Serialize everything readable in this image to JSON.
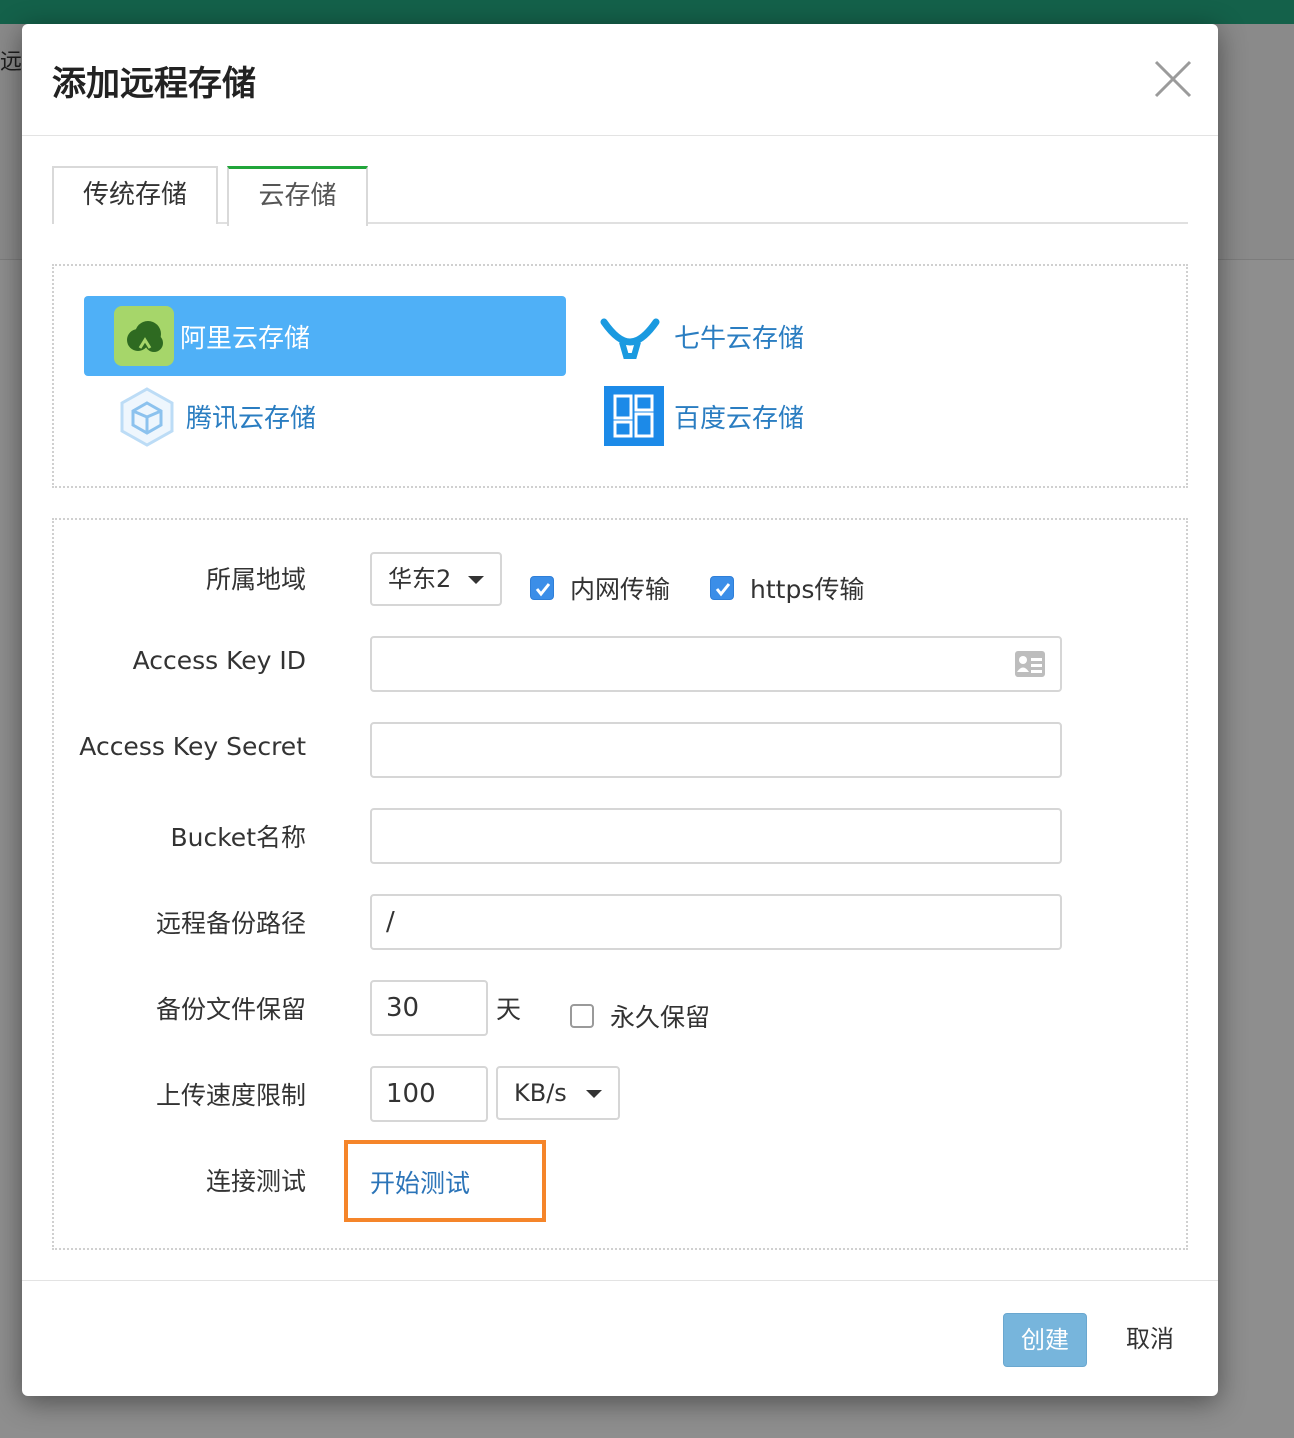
{
  "background": {
    "partial_text": "远"
  },
  "dialog": {
    "title": "添加远程存储",
    "tabs": [
      {
        "label": "传统存储"
      },
      {
        "label": "云存储",
        "active": true
      }
    ],
    "providers": [
      {
        "label": "阿里云存储",
        "icon": "aliyun-icon",
        "active": true
      },
      {
        "label": "七牛云存储",
        "icon": "qiniu-icon"
      },
      {
        "label": "腾讯云存储",
        "icon": "tencent-cloud-icon"
      },
      {
        "label": "百度云存储",
        "icon": "baidu-cloud-icon"
      }
    ],
    "form": {
      "region_label": "所属地域",
      "region_value": "华东2",
      "intranet_label": "内网传输",
      "intranet_checked": true,
      "https_label": "https传输",
      "https_checked": true,
      "access_key_id_label": "Access Key ID",
      "access_key_id_value": "",
      "access_key_secret_label": "Access Key Secret",
      "access_key_secret_value": "",
      "bucket_label": "Bucket名称",
      "bucket_value": "",
      "path_label": "远程备份路径",
      "path_value": "/",
      "retention_label": "备份文件保留",
      "retention_value": "30",
      "retention_unit": "天",
      "permanent_label": "永久保留",
      "permanent_checked": false,
      "speed_label": "上传速度限制",
      "speed_value": "100",
      "speed_unit": "KB/s",
      "test_label": "连接测试",
      "test_link": "开始测试"
    },
    "footer": {
      "create": "创建",
      "cancel": "取消"
    },
    "colors": {
      "accent_tab": "#20a53a",
      "provider_active": "#4fb0f7",
      "create_button": "#77b5dc",
      "highlight_box": "#f5852a",
      "topbar": "#14614a"
    }
  }
}
